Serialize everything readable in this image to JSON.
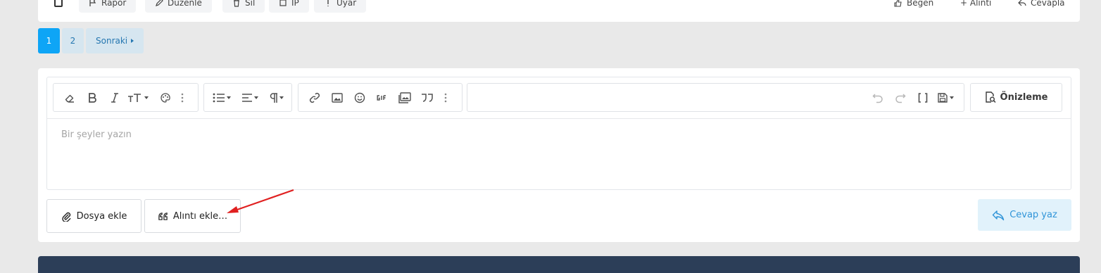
{
  "post_actions": {
    "items": [
      {
        "label": "Rapor",
        "icon": "flag-icon"
      },
      {
        "label": "Düzenle",
        "icon": "edit-icon"
      },
      {
        "label": "Sil",
        "icon": "trash-icon"
      },
      {
        "label": "IP",
        "icon": "ip-icon"
      },
      {
        "label": "Uyar",
        "icon": "warn-icon"
      },
      {
        "label": "Beğen",
        "icon": "thumbs-up-icon"
      },
      {
        "label": "+ Alıntı",
        "icon": "plus-icon"
      },
      {
        "label": "Cevapla",
        "icon": "reply-icon"
      }
    ]
  },
  "pagination": {
    "pages": [
      "1",
      "2"
    ],
    "current": "1",
    "next_label": "Sonraki"
  },
  "editor": {
    "placeholder": "Bir şeyler yazın",
    "preview_label": "Önizleme"
  },
  "buttons": {
    "attach_file": "Dosya ekle",
    "insert_quote": "Alıntı ekle…",
    "post_reply": "Cevap yaz"
  },
  "colors": {
    "accent": "#0ea5f6",
    "reply_button_bg": "#e1f2fb",
    "reply_button_text": "#2f94d8",
    "annotation_arrow": "#e02020",
    "footer_block": "#2c3e58"
  }
}
